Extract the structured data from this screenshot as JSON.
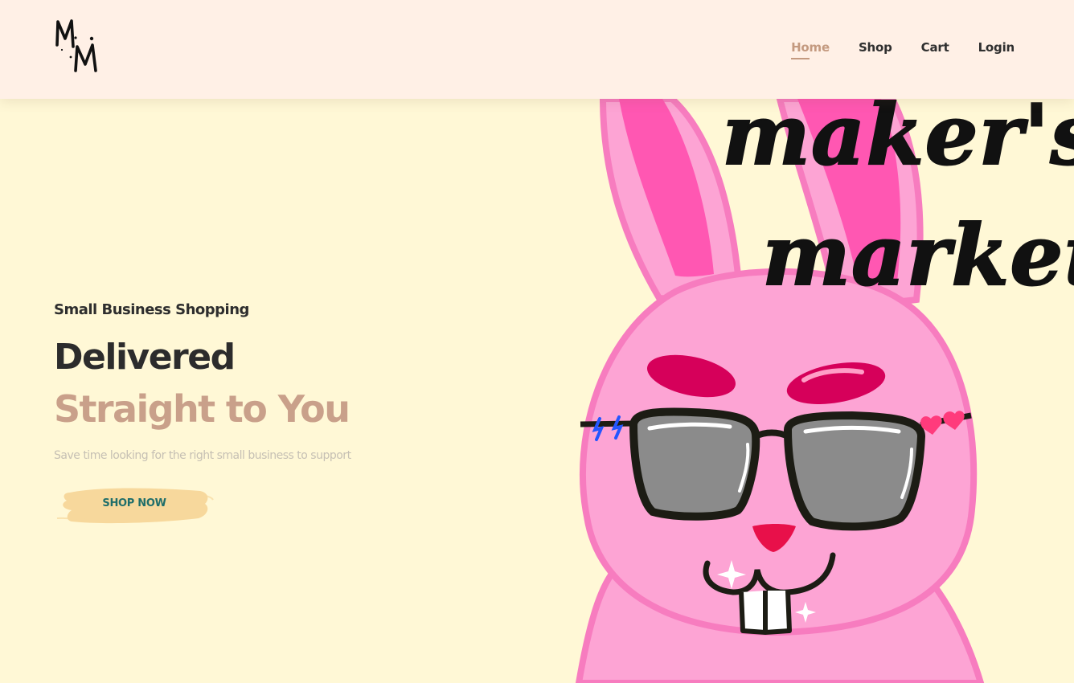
{
  "header": {
    "logo_text": "MM",
    "nav": [
      {
        "label": "Home",
        "active": true
      },
      {
        "label": "Shop",
        "active": false
      },
      {
        "label": "Cart",
        "active": false
      },
      {
        "label": "Login",
        "active": false
      }
    ]
  },
  "hero": {
    "eyebrow": "Small Business Shopping",
    "headline_line1": "Delivered",
    "headline_line2": "Straight to You",
    "subtext": "Save time looking for the right small business to support",
    "cta_label": "SHOP NOW"
  },
  "artwork": {
    "brand_line1": "maker's",
    "brand_line2": "market"
  },
  "colors": {
    "page_background": "#fff8d6",
    "header_background": "#fff0e6",
    "accent": "#c49a80",
    "headline_accent": "#c9a08a",
    "cta_brush": "#f7d89c",
    "cta_text": "#1f6e6a",
    "bunny_pink": "#fda4d4",
    "bunny_outline": "#f77cbf"
  }
}
